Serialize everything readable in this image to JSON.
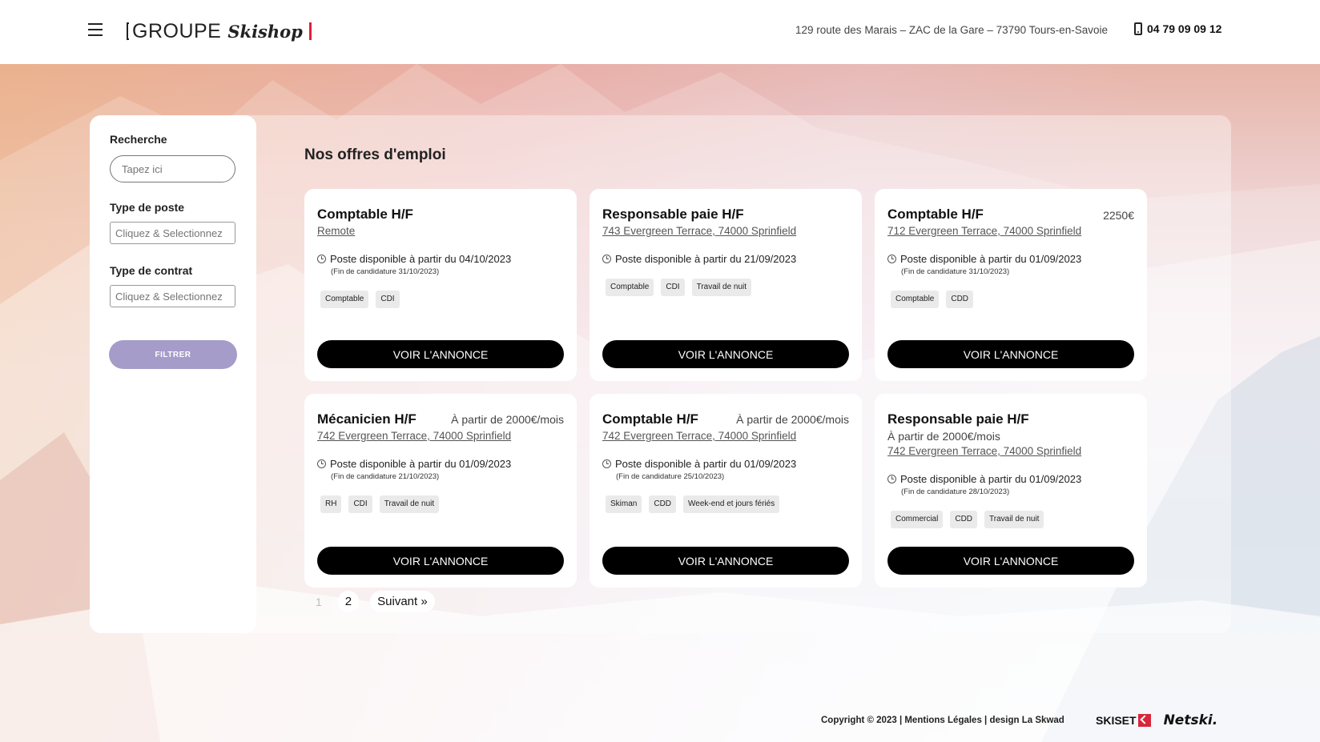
{
  "header": {
    "logo_groupe": "GROUPE",
    "logo_skishop": "Skishop",
    "address": "129 route des Marais – ZAC de la Gare – 73790 Tours-en-Savoie",
    "phone": "04 79 09 09 12"
  },
  "sidebar": {
    "search_label": "Recherche",
    "search_placeholder": "Tapez ici",
    "post_type_label": "Type de poste",
    "post_type_placeholder": "Cliquez & Selectionnez",
    "contract_type_label": "Type de contrat",
    "contract_type_placeholder": "Cliquez & Selectionnez",
    "filter_label": "FILTRER"
  },
  "main": {
    "title": "Nos offres d'emploi",
    "button_label": "VOIR L'ANNONCE",
    "cards": [
      {
        "title": "Comptable H/F",
        "salary": "",
        "location": "Remote",
        "available": "Poste disponible à partir du 04/10/2023",
        "deadline": "(Fin de candidature 31/10/2023)",
        "tags": [
          "Comptable",
          "CDI"
        ]
      },
      {
        "title": "Responsable paie H/F",
        "salary": "",
        "location": "743 Evergreen Terrace, 74000 Sprinfield",
        "available": "Poste disponible à partir du 21/09/2023",
        "deadline": "",
        "tags": [
          "Comptable",
          "CDI",
          "Travail de nuit"
        ]
      },
      {
        "title": "Comptable H/F",
        "salary": "2250€",
        "location": "712 Evergreen Terrace, 74000 Sprinfield",
        "available": "Poste disponible à partir du 01/09/2023",
        "deadline": "(Fin de candidature 31/10/2023)",
        "tags": [
          "Comptable",
          "CDD"
        ]
      },
      {
        "title": "Mécanicien H/F",
        "salary": "À partir de 2000€/mois",
        "location": "742 Evergreen Terrace, 74000 Sprinfield",
        "available": "Poste disponible à partir du 01/09/2023",
        "deadline": "(Fin de candidature 21/10/2023)",
        "tags": [
          "RH",
          "CDI",
          "Travail de nuit"
        ]
      },
      {
        "title": "Comptable H/F",
        "salary": "À partir de 2000€/mois",
        "location": "742 Evergreen Terrace, 74000 Sprinfield",
        "available": "Poste disponible à partir du 01/09/2023",
        "deadline": "(Fin de candidature 25/10/2023)",
        "tags": [
          "Skiman",
          "CDD",
          "Week-end et jours fériés"
        ]
      },
      {
        "title": "Responsable paie H/F",
        "salary": "À partir de 2000€/mois",
        "location": "742 Evergreen Terrace, 74000 Sprinfield",
        "available": "Poste disponible à partir du 01/09/2023",
        "deadline": "(Fin de candidature 28/10/2023)",
        "tags": [
          "Commercial",
          "CDD",
          "Travail de nuit"
        ]
      }
    ]
  },
  "pagination": {
    "current": "1",
    "page2": "2",
    "next": "Suivant »"
  },
  "footer": {
    "copyright": "Copyright © 2023 | Mentions Légales | design La Skwad",
    "logo_skiset": "SKISET",
    "logo_netski": "Netski."
  }
}
